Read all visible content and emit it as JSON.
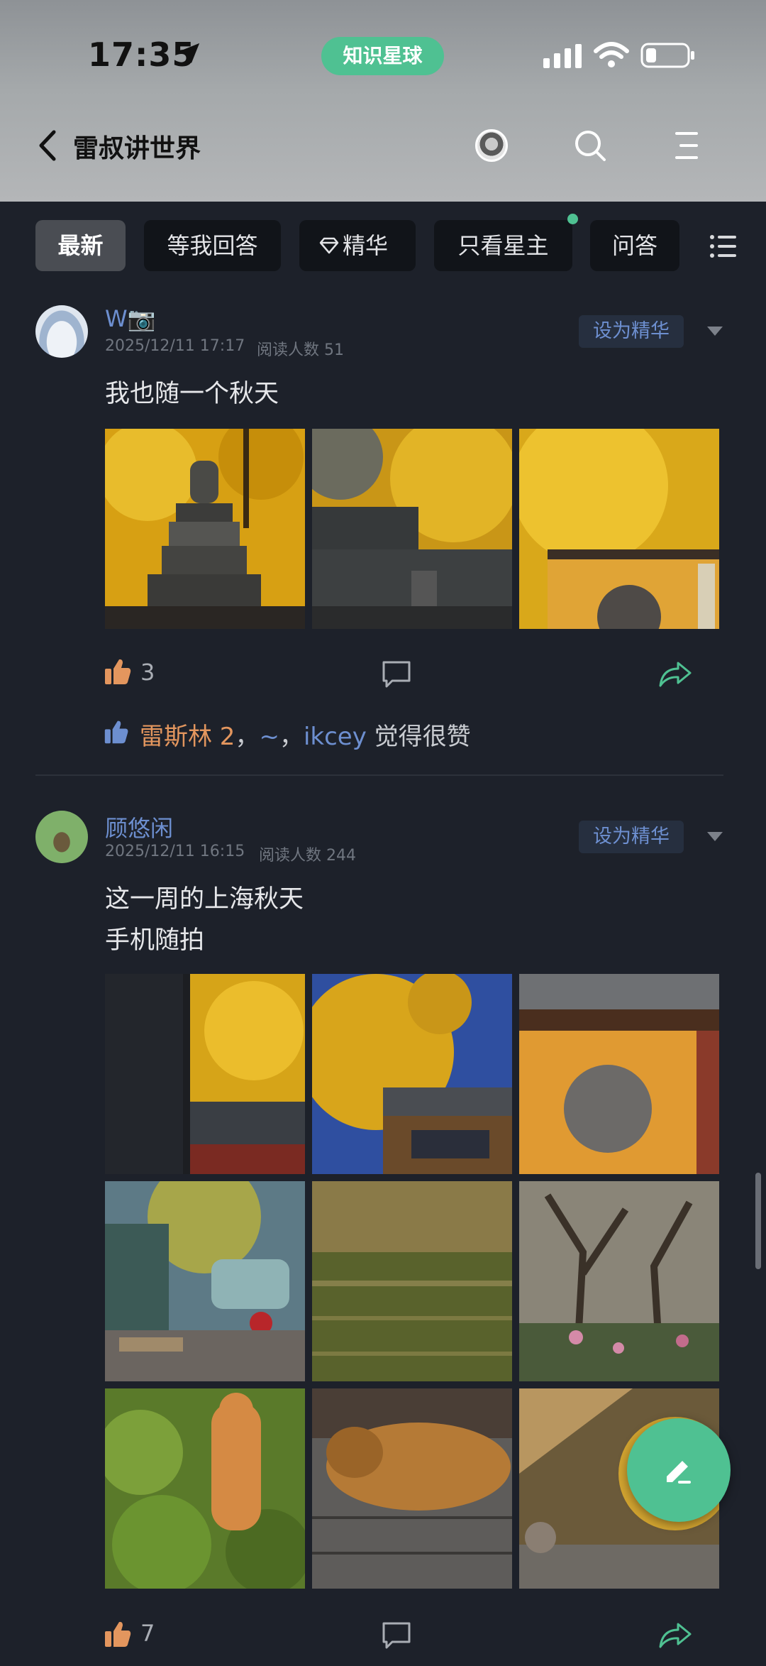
{
  "status_bar": {
    "time": "17:35",
    "pill": "知识星球"
  },
  "header": {
    "title": "雷叔讲世界"
  },
  "tabs": [
    {
      "label": "最新",
      "active": true
    },
    {
      "label": "等我回答"
    },
    {
      "label": "精华",
      "icon": "diamond-icon"
    },
    {
      "label": "只看星主",
      "has_dot": true
    },
    {
      "label": "问答"
    }
  ],
  "posts": [
    {
      "username": "W📷",
      "date": "2025/12/11 17:17",
      "reads": "阅读人数 51",
      "set_featured": "设为精华",
      "text": "我也随一个秋天",
      "likes": "3",
      "likers": {
        "first": "雷斯林 2",
        "sep1": "，",
        "second": "~",
        "sep2": "，",
        "third": "ikcey",
        "suffix": " 觉得很赞"
      }
    },
    {
      "username": "顾悠闲",
      "date": "2025/12/11 16:15",
      "reads": "阅读人数 244",
      "set_featured": "设为精华",
      "text": "这一周的上海秋天\n手机随拍",
      "likes": "7"
    }
  ],
  "colors": {
    "accent": "#4fc192",
    "link": "#6d8fd0",
    "like": "#e3965e",
    "background": "#1d212a"
  }
}
